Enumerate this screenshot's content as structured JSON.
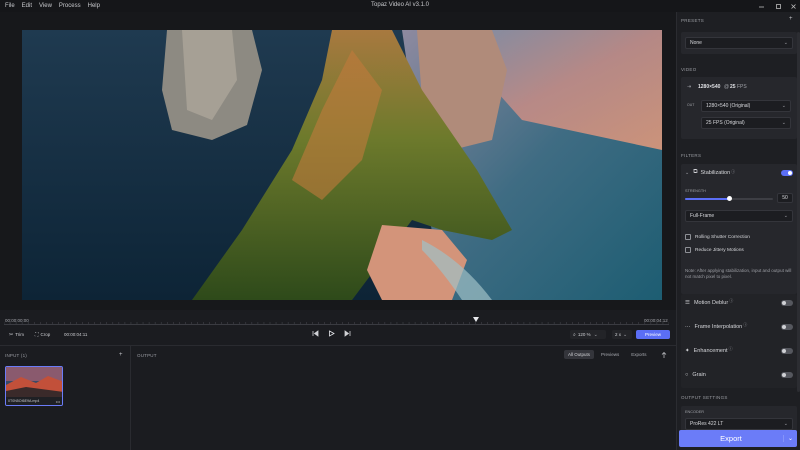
{
  "menu": [
    "File",
    "Edit",
    "View",
    "Process",
    "Help"
  ],
  "app_title": "Topaz Video AI  v3.1.0",
  "timeline": {
    "start_time": "00:00:00:00",
    "end_time": "00:00:04:12",
    "trim_label": "Trim",
    "crop_label": "Crop",
    "current_time": "00:00:04:11",
    "zoom": "120 %",
    "speed": "2 x",
    "preview_label": "Preview",
    "playhead_fraction": 0.71
  },
  "input": {
    "label": "INPUT (1)",
    "file_name": "0T0N5OI6E9A.mp4"
  },
  "output": {
    "label": "OUTPUT",
    "tabs": [
      "All Outputs",
      "Previews",
      "Exports"
    ]
  },
  "panel": {
    "presets_label": "PRESETS",
    "preset_value": "None",
    "video_label": "VIDEO",
    "source_res": "1280×540",
    "source_fps": "25",
    "fps_unit": "FPS",
    "out_label": "OUT",
    "res_option": "1280×540 (Original)",
    "fps_option": "25 FPS (Original)",
    "filters_label": "FILTERS",
    "stabilization": {
      "label": "Stabilization",
      "strength_label": "STRENGTH",
      "strength_value": "50",
      "strength_fraction": 0.5,
      "mode": "Full-Frame",
      "rolling_shutter": "Rolling Shutter Correction",
      "jittery": "Reduce Jittery Motions",
      "note": "Note: After applying stabilization, input and output will not match pixel to pixel."
    },
    "filters": [
      "Motion Deblur",
      "Frame Interpolation",
      "Enhancement",
      "Grain"
    ],
    "output_settings_label": "OUTPUT SETTINGS",
    "encoder_label": "ENCODER",
    "encoder_value": "ProRes 422 LT",
    "export_label": "Export"
  },
  "colors": {
    "accent": "#5b6ef5",
    "export_bg": "#6b7cf8"
  }
}
